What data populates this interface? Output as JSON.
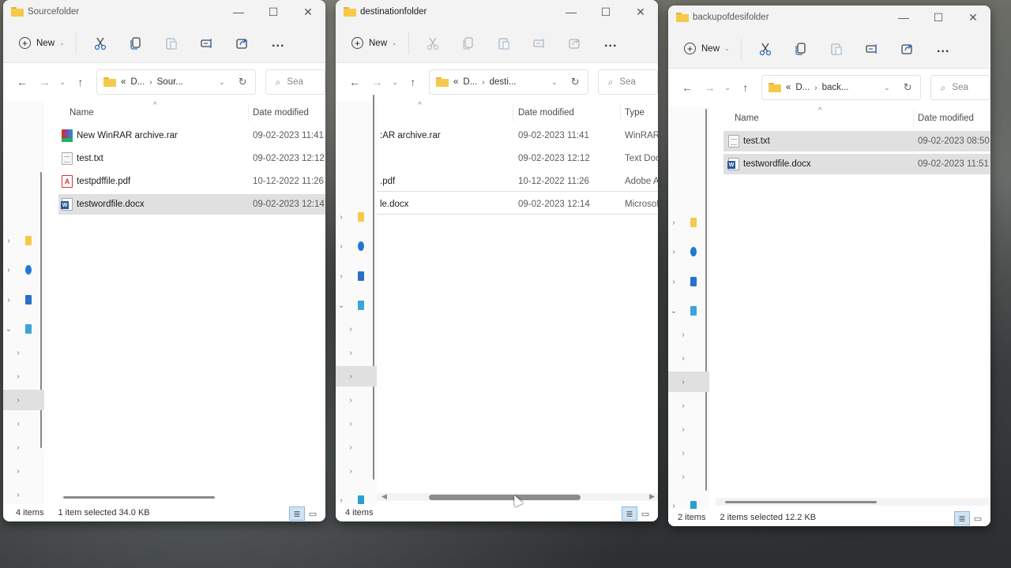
{
  "windows": [
    {
      "id": "source",
      "title": "Sourcefolder",
      "toolbar": {
        "new_label": "New",
        "more_label": "..."
      },
      "address": {
        "overflow": "«",
        "crumbs": [
          "D...",
          "Sour..."
        ]
      },
      "search_placeholder": "Sea",
      "columns": [
        "Name",
        "Date modified"
      ],
      "files": [
        {
          "name": "New WinRAR archive.rar",
          "icon": "winrar-icon",
          "date": "09-02-2023 11:41",
          "selected": false
        },
        {
          "name": "test.txt",
          "icon": "text-file-icon",
          "date": "09-02-2023 12:12",
          "selected": false
        },
        {
          "name": "testpdffile.pdf",
          "icon": "pdf-icon",
          "date": "10-12-2022 11:26",
          "selected": false
        },
        {
          "name": "testwordfile.docx",
          "icon": "word-icon",
          "date": "09-02-2023 12:14",
          "selected": true
        }
      ],
      "status": {
        "count": "4 items",
        "selection": "1 item selected  34.0 KB"
      }
    },
    {
      "id": "destination",
      "title": "destinationfolder",
      "toolbar": {
        "new_label": "New",
        "more_label": "..."
      },
      "address": {
        "overflow": "«",
        "crumbs": [
          "D...",
          "desti..."
        ]
      },
      "search_placeholder": "Sea",
      "columns": [
        "Date modified",
        "Type"
      ],
      "files": [
        {
          "name": ":AR archive.rar",
          "date": "09-02-2023 11:41",
          "type": "WinRAR"
        },
        {
          "name": "",
          "date": "09-02-2023 12:12",
          "type": "Text Doc"
        },
        {
          "name": ".pdf",
          "date": "10-12-2022 11:26",
          "type": "Adobe A"
        },
        {
          "name": "le.docx",
          "date": "09-02-2023 12:14",
          "type": "Microsof"
        }
      ],
      "status": {
        "count": "4 items",
        "selection": ""
      }
    },
    {
      "id": "backup",
      "title": "backupofdesifolder",
      "toolbar": {
        "new_label": "New",
        "more_label": "..."
      },
      "address": {
        "overflow": "«",
        "crumbs": [
          "D...",
          "back..."
        ]
      },
      "search_placeholder": "Sea",
      "columns": [
        "Name",
        "Date modified"
      ],
      "files": [
        {
          "name": "test.txt",
          "icon": "text-file-icon",
          "date": "09-02-2023 08:50",
          "selected": true
        },
        {
          "name": "testwordfile.docx",
          "icon": "word-icon",
          "date": "09-02-2023 11:51",
          "selected": true
        }
      ],
      "status": {
        "count": "2 items",
        "selection": "2 items selected  12.2 KB"
      }
    }
  ],
  "glyphs": {
    "minimize": "—",
    "maximize": "☐",
    "close": "✕",
    "back": "←",
    "forward": "→",
    "recent": "⌄",
    "up": "↑",
    "crumb_sep": "›",
    "dropdown": "⌄",
    "refresh": "↻",
    "search": "⌕",
    "expand": "›",
    "collapse": "⌄",
    "sort_up": "^",
    "details_view": "≣",
    "tiles_view": "▭",
    "scroll_left": "◀",
    "scroll_right": "▶"
  },
  "colors": {
    "selection": "#e0e0e0",
    "view_active": "#cfe3f5",
    "folder": "#f6c94a"
  }
}
